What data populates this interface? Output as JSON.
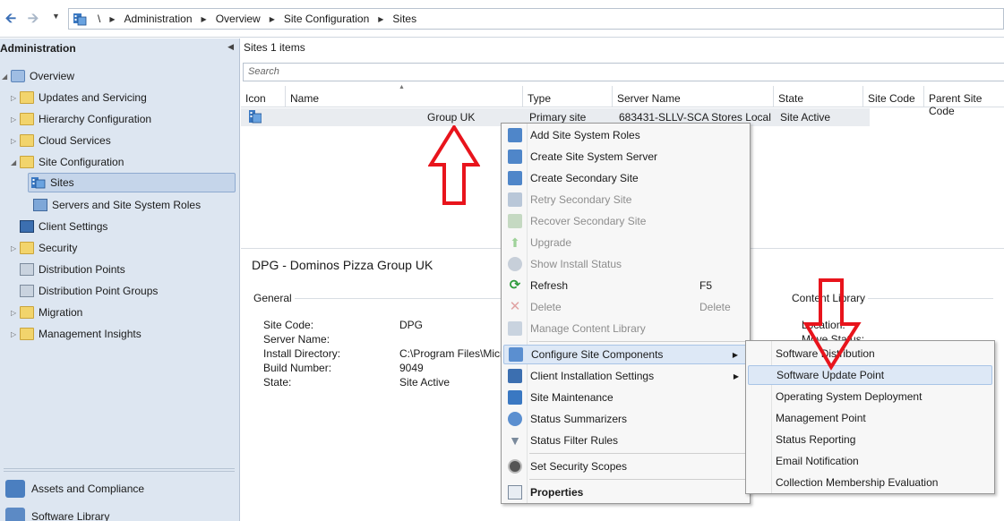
{
  "address_bar": {
    "back_icon": "back-arrow-icon",
    "forward_icon": "forward-arrow-icon",
    "crumbs": [
      "\\",
      "Administration",
      "Overview",
      "Site Configuration",
      "Sites"
    ]
  },
  "nav": {
    "header": "Administration",
    "tree": {
      "overview": "Overview",
      "updates": "Updates and Servicing",
      "hierarchy": "Hierarchy Configuration",
      "cloud": "Cloud Services",
      "site_config": "Site Configuration",
      "sites": "Sites",
      "servers_roles": "Servers and Site System Roles",
      "client_settings": "Client Settings",
      "security": "Security",
      "dist_points": "Distribution Points",
      "dist_point_groups": "Distribution Point Groups",
      "migration": "Migration",
      "mgmt_insights": "Management Insights"
    },
    "workspaces": [
      "Assets and Compliance",
      "Software Library"
    ]
  },
  "list": {
    "title": "Sites 1 items",
    "search_placeholder": "Search",
    "columns": [
      "Icon",
      "Name",
      "Type",
      "Server Name",
      "State",
      "Site Code",
      "Parent Site Code"
    ],
    "row": {
      "name": "Group UK",
      "type": "Primary site",
      "server": "683431-SLLV-SCA Stores Local",
      "state": "Site Active"
    }
  },
  "details": {
    "title": "DPG - Dominos Pizza Group UK",
    "general_label": "General",
    "content_library_label": "Content Library",
    "content_fields": [
      "Location:",
      "Move Status:"
    ],
    "fields": [
      {
        "key": "Site Code:",
        "value": "DPG"
      },
      {
        "key": "Server Name:",
        "value": ""
      },
      {
        "key": "Install Directory:",
        "value": "C:\\Program Files\\Micr"
      },
      {
        "key": "Build Number:",
        "value": "9049"
      },
      {
        "key": "State:",
        "value": "Site Active"
      }
    ]
  },
  "context_menu": {
    "items": {
      "add_roles": "Add Site System Roles",
      "create_server": "Create Site System Server",
      "create_secondary": "Create Secondary Site",
      "retry_secondary": "Retry Secondary Site",
      "recover_secondary": "Recover Secondary Site",
      "upgrade": "Upgrade",
      "show_install": "Show Install Status",
      "refresh": "Refresh",
      "refresh_shortcut": "F5",
      "delete": "Delete",
      "delete_shortcut": "Delete",
      "manage_content": "Manage Content Library",
      "configure_components": "Configure Site Components",
      "client_install": "Client Installation Settings",
      "maintenance": "Site Maintenance",
      "summarizers": "Status Summarizers",
      "filter_rules": "Status Filter Rules",
      "security_scopes": "Set Security Scopes",
      "properties": "Properties"
    }
  },
  "submenu": {
    "items": [
      "Software Distribution",
      "Software Update Point",
      "Operating System Deployment",
      "Management Point",
      "Status Reporting",
      "Email Notification",
      "Collection Membership Evaluation"
    ]
  },
  "colors": {
    "annotation_red": "#e8141c",
    "nav_bg": "#dde6f1",
    "menu_hover": "#dde8f6"
  }
}
